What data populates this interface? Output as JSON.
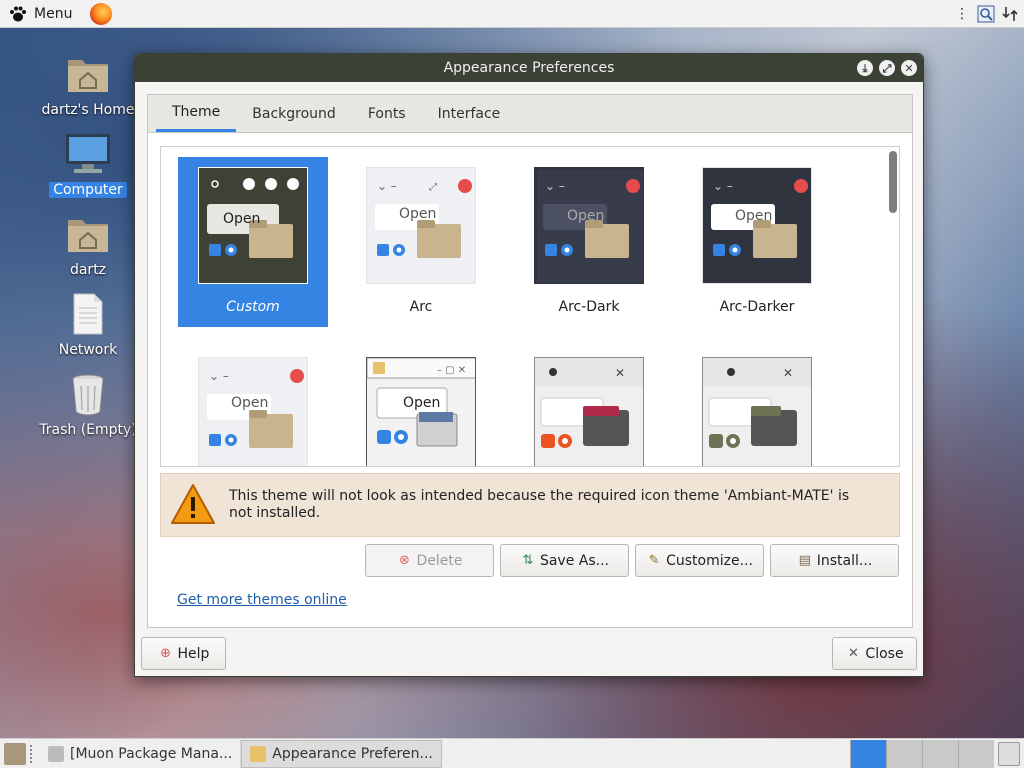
{
  "top_panel": {
    "menu_label": "Menu",
    "tray_icons": [
      "vertical-dots-icon",
      "search-tool-icon",
      "network-icon"
    ]
  },
  "desktop_icons": [
    {
      "label": "dartz's Home",
      "icon": "home-folder-icon"
    },
    {
      "label": "Computer",
      "icon": "computer-icon"
    },
    {
      "label": "dartz",
      "icon": "home-folder-icon"
    },
    {
      "label": "Network",
      "icon": "document-icon"
    },
    {
      "label": "Trash (Empty)",
      "icon": "trash-icon"
    }
  ],
  "window": {
    "title": "Appearance Preferences",
    "tabs": [
      {
        "label": "Theme",
        "active": true
      },
      {
        "label": "Background",
        "active": false
      },
      {
        "label": "Fonts",
        "active": false
      },
      {
        "label": "Interface",
        "active": false
      }
    ],
    "themes": [
      {
        "name": "Custom",
        "selected": true
      },
      {
        "name": "Arc",
        "selected": false
      },
      {
        "name": "Arc-Dark",
        "selected": false
      },
      {
        "name": "Arc-Darker",
        "selected": false
      },
      {
        "name": "",
        "selected": false
      },
      {
        "name": "",
        "selected": false
      },
      {
        "name": "",
        "selected": false
      },
      {
        "name": "",
        "selected": false
      }
    ],
    "thumb_open_label": "Open",
    "warning_text": "This theme will not look as intended because the required icon theme 'Ambiant-MATE' is not installed.",
    "buttons": {
      "delete": "Delete",
      "save_as": "Save As...",
      "customize": "Customize...",
      "install": "Install..."
    },
    "link": "Get more themes online",
    "help": "Help",
    "close": "Close"
  },
  "taskbar": {
    "tasks": [
      {
        "label": "[Muon Package Mana...",
        "active": false
      },
      {
        "label": "Appearance Preferen...",
        "active": true
      }
    ]
  },
  "colors": {
    "accent": "#3584e4",
    "titlebar": "#3c4136",
    "warning_bg": "#f0e4d6"
  }
}
